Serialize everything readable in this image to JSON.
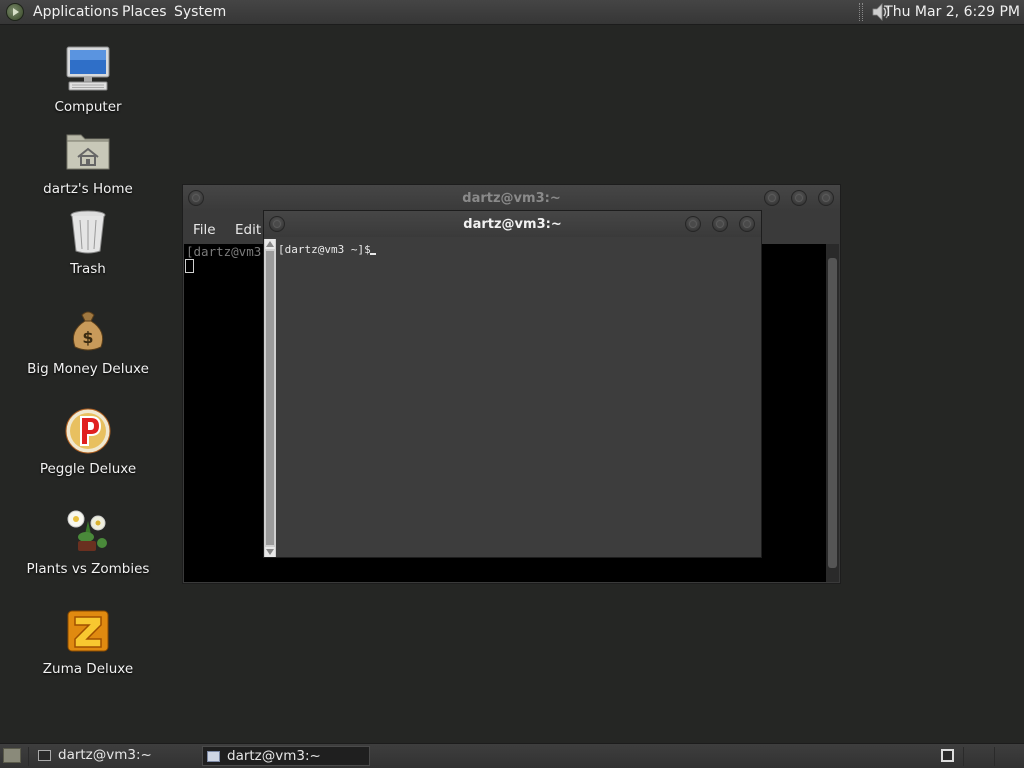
{
  "top_panel": {
    "menus": [
      "Applications",
      "Places",
      "System"
    ],
    "clock": "Thu Mar  2,  6:29 PM",
    "volume_icon": "speaker-icon"
  },
  "desktop_icons": [
    {
      "label": "Computer",
      "icon": "computer-icon"
    },
    {
      "label": "dartz's Home",
      "icon": "home-folder-icon"
    },
    {
      "label": "Trash",
      "icon": "trash-icon"
    },
    {
      "label": "Big Money Deluxe",
      "icon": "money-bag-icon"
    },
    {
      "label": "Peggle Deluxe",
      "icon": "peggle-icon"
    },
    {
      "label": "Plants vs Zombies",
      "icon": "plants-vs-zombies-icon"
    },
    {
      "label": "Zuma Deluxe",
      "icon": "zuma-icon"
    }
  ],
  "back_window": {
    "title": "dartz@vm3:~",
    "menu": [
      "File",
      "Edit"
    ],
    "prompt": "[dartz@vm3"
  },
  "front_window": {
    "title": "dartz@vm3:~",
    "prompt": "[dartz@vm3 ~]$ "
  },
  "taskbar": {
    "tasks": [
      {
        "label": "dartz@vm3:~",
        "active": false
      },
      {
        "label": "dartz@vm3:~",
        "active": true
      }
    ]
  }
}
